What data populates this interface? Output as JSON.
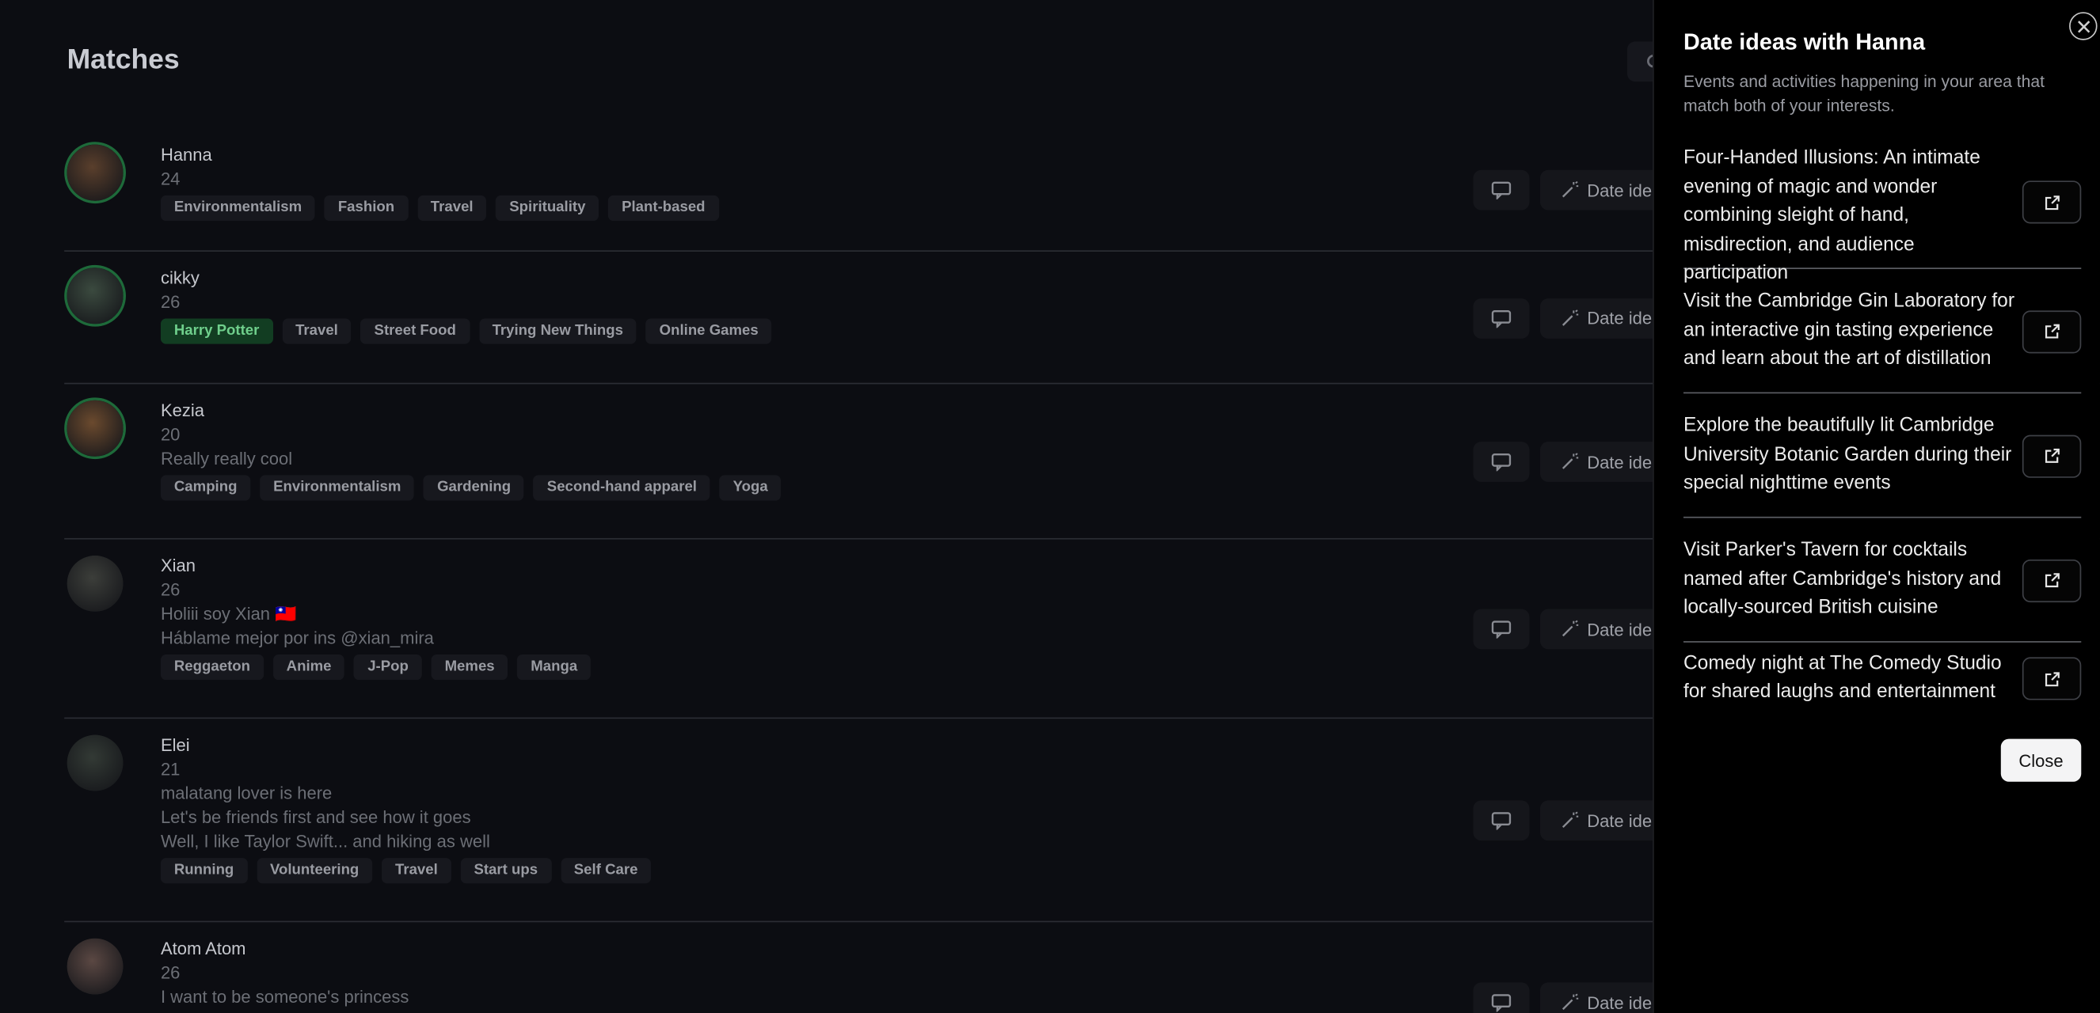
{
  "page": {
    "title": "Matches"
  },
  "matches": [
    {
      "name": "Hanna",
      "age": "24",
      "bio": [],
      "tags": [
        "Environmentalism",
        "Fashion",
        "Travel",
        "Spirituality",
        "Plant-based"
      ],
      "highlight": [],
      "avatar_color": "#5a3f2c",
      "ring": true
    },
    {
      "name": "cikky",
      "age": "26",
      "bio": [],
      "tags": [
        "Harry Potter",
        "Travel",
        "Street Food",
        "Trying New Things",
        "Online Games"
      ],
      "highlight": [
        0
      ],
      "avatar_color": "#3b4a3f",
      "ring": true
    },
    {
      "name": "Kezia",
      "age": "20",
      "bio": [
        "Really really cool"
      ],
      "tags": [
        "Camping",
        "Environmentalism",
        "Gardening",
        "Second-hand apparel",
        "Yoga"
      ],
      "highlight": [],
      "avatar_color": "#6b4a2e",
      "ring": true
    },
    {
      "name": "Xian",
      "age": "26",
      "bio": [
        "Holiii soy Xian 🇹🇼",
        "Háblame mejor por ins @xian_mira"
      ],
      "tags": [
        "Reggaeton",
        "Anime",
        "J-Pop",
        "Memes",
        "Manga"
      ],
      "highlight": [],
      "avatar_color": "#3c3e3a",
      "ring": false
    },
    {
      "name": "Elei",
      "age": "21",
      "bio": [
        "malatang lover is here",
        "Let's be friends first and see how it goes",
        "Well, I like Taylor Swift... and hiking as well"
      ],
      "tags": [
        "Running",
        "Volunteering",
        "Travel",
        "Start ups",
        "Self Care"
      ],
      "highlight": [],
      "avatar_color": "#333a35",
      "ring": false
    },
    {
      "name": "Atom Atom",
      "age": "26",
      "bio": [
        "I want to be someone's princess"
      ],
      "tags": [],
      "highlight": [],
      "avatar_color": "#5b4843",
      "ring": false
    }
  ],
  "actions": {
    "date_label": "Date ideas"
  },
  "drawer": {
    "title": "Date ideas with Hanna",
    "subtitle": "Events and activities happening in your area that match both of your interests.",
    "ideas": [
      "Four-Handed Illusions: An intimate evening of magic and wonder combining sleight of hand, misdirection, and audience participation",
      "Visit the Cambridge Gin Laboratory for an interactive gin tasting experience and learn about the art of distillation",
      "Explore the beautifully lit Cambridge University Botanic Garden during their special nighttime events",
      "Visit Parker's Tavern for cocktails named after Cambridge's history and locally-sourced British cuisine",
      "Comedy night at The Comedy Studio for shared laughs and entertainment"
    ],
    "close_label": "Close"
  },
  "colors": {
    "accent_green": "#1e6a3a",
    "drawer_bg": "#000000",
    "overlay_bg": "#0c0d12"
  },
  "icons": [
    "search-icon",
    "chat-icon",
    "wand-icon",
    "external-link-icon",
    "close-icon"
  ]
}
